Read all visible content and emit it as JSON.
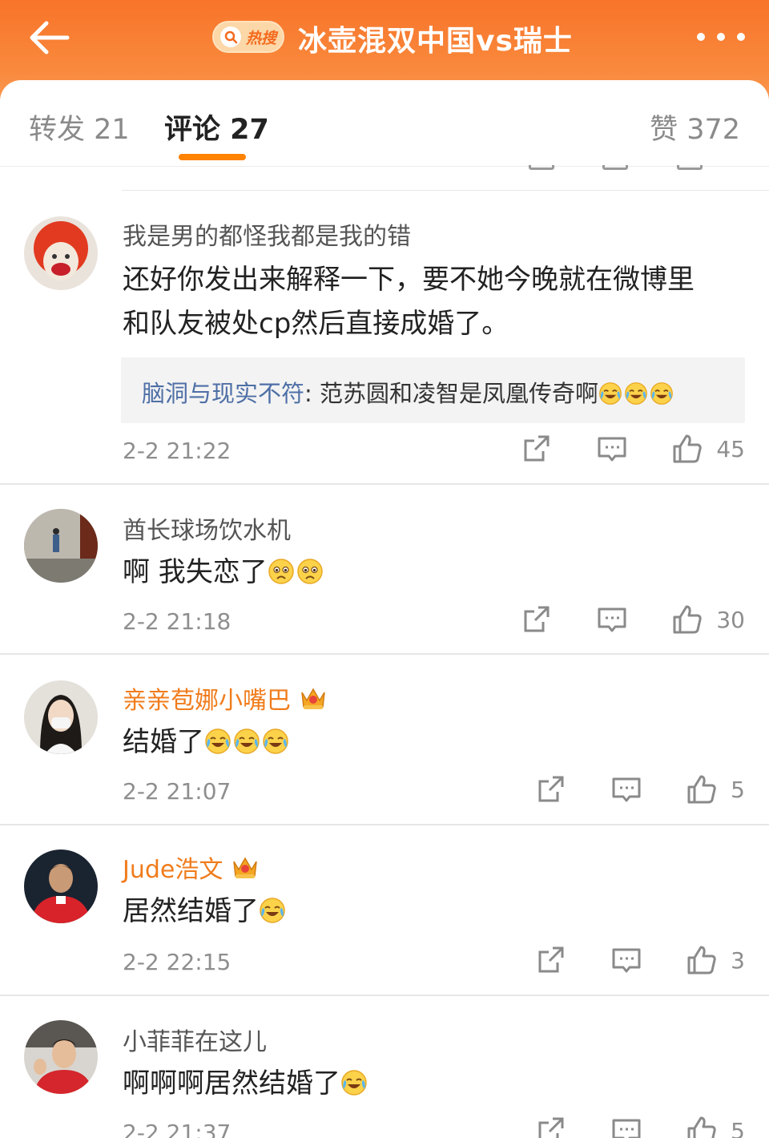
{
  "header": {
    "hot_badge": "热搜",
    "title": "冰壶混双中国vs瑞士"
  },
  "tabs": {
    "repost": "转发 21",
    "comment": "评论 27",
    "like": "赞 372"
  },
  "comments": [
    {
      "user": "我是男的都怪我都是我的错",
      "text_line1": "还好你发出来解释一下，要不她今晚就在微博里",
      "text_line2": "和队友被处cp然后直接成婚了。",
      "reply_user": "脑洞与现实不符",
      "reply_text": ": 范苏圆和凌智是凤凰传奇啊",
      "time": "2-2 21:22",
      "likes": "45"
    },
    {
      "user": "酋长球场饮水机",
      "text": "啊 我失恋了",
      "time": "2-2 21:18",
      "likes": "30"
    },
    {
      "user": "亲亲苞娜小嘴巴",
      "text": "结婚了",
      "time": "2-2 21:07",
      "likes": "5"
    },
    {
      "user": "Jude浩文",
      "text": "居然结婚了",
      "time": "2-2 22:15",
      "likes": "3"
    },
    {
      "user": "小菲菲在这儿",
      "text": "啊啊啊居然结婚了",
      "time": "2-2 21:37",
      "likes": "5"
    }
  ],
  "colors": {
    "header_orange": "#f8742a",
    "accent": "#ff8200",
    "vip_name": "#f07c1c",
    "reply_user": "#4e6fa6"
  },
  "icons": [
    "back-arrow-icon",
    "search-icon",
    "more-icon",
    "share-icon",
    "reply-icon",
    "like-icon",
    "crown-icon",
    "laugh-cry-emoji",
    "sad-emoji"
  ]
}
